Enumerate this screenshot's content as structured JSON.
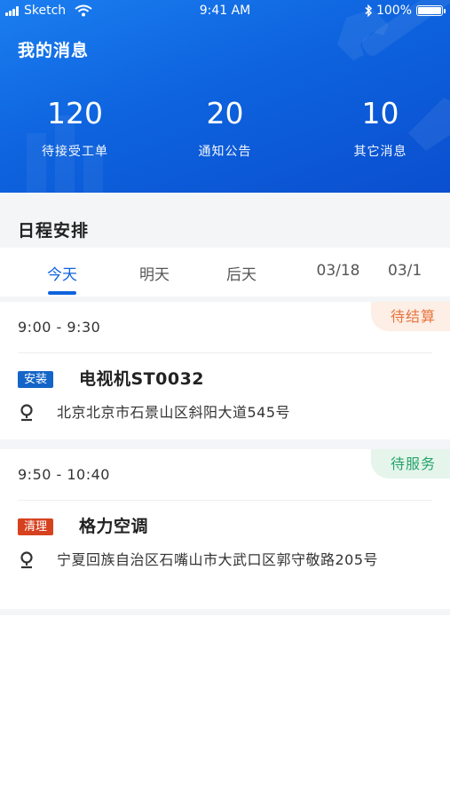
{
  "status_bar": {
    "carrier": "Sketch",
    "time": "9:41 AM",
    "battery": "100%",
    "battery_level": 1.0
  },
  "header": {
    "title": "我的消息",
    "stats": [
      {
        "value": "120",
        "label": "待接受工单"
      },
      {
        "value": "20",
        "label": "通知公告"
      },
      {
        "value": "10",
        "label": "其它消息"
      }
    ]
  },
  "schedule": {
    "title": "日程安排",
    "tabs": [
      "今天",
      "明天",
      "后天",
      "03/18",
      "03/1"
    ],
    "active_tab": 0
  },
  "orders": [
    {
      "time": "9:00 - 9:30",
      "status": "待结算",
      "status_color": "#e8743b",
      "status_bg": "#fdeee6",
      "tag": "安装",
      "tag_color": "#1465c7",
      "name": "电视机ST0032",
      "address": "北京北京市石景山区斜阳大道545号"
    },
    {
      "time": "9:50 - 10:40",
      "status": "待服务",
      "status_color": "#27a36b",
      "status_bg": "#e5f5ec",
      "tag": "清理",
      "tag_color": "#d6421f",
      "name": "格力空调",
      "address": "宁夏回族自治区石嘴山市大武口区郭守敬路205号"
    }
  ],
  "icons": {
    "signal": "signal-bars-icon",
    "wifi": "wifi-icon",
    "bluetooth": "bluetooth-icon",
    "battery": "battery-icon",
    "location": "location-pin-icon",
    "background": "wrench-icon"
  },
  "colors": {
    "brand_blue": "#0e63de",
    "page_bg": "#f4f5f7"
  }
}
